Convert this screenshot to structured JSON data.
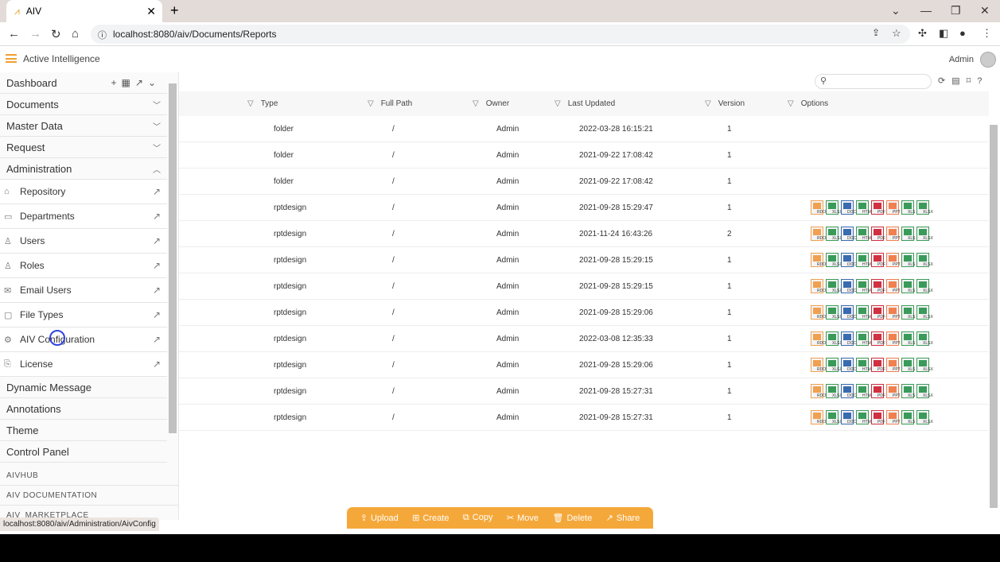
{
  "browser": {
    "tab_title": "AIV",
    "url": "localhost:8080/aiv/Documents/Reports",
    "status_url": "localhost:8080/aiv/Administration/AivConfig"
  },
  "app": {
    "brand": "Active Intelligence",
    "user": "Admin"
  },
  "sidebar": {
    "menus": [
      {
        "label": "Dashboard"
      },
      {
        "label": "Documents"
      },
      {
        "label": "Master Data"
      },
      {
        "label": "Request"
      },
      {
        "label": "Administration"
      }
    ],
    "admin_items": [
      {
        "label": "Repository",
        "icon": "repository-icon"
      },
      {
        "label": "Departments",
        "icon": "departments-icon"
      },
      {
        "label": "Users",
        "icon": "user-icon"
      },
      {
        "label": "Roles",
        "icon": "roles-icon"
      },
      {
        "label": "Email Users",
        "icon": "email-users-icon"
      },
      {
        "label": "File Types",
        "icon": "file-types-icon"
      },
      {
        "label": "AIV Configuration",
        "icon": "config-icon"
      },
      {
        "label": "License",
        "icon": "license-icon"
      }
    ],
    "more": [
      {
        "label": "Dynamic Message"
      },
      {
        "label": "Annotations"
      },
      {
        "label": "Theme"
      },
      {
        "label": "Control Panel"
      }
    ],
    "links": [
      {
        "label": "AIVHUB"
      },
      {
        "label": "AIV DOCUMENTATION"
      },
      {
        "label": "AIV_MARKETPLACE"
      }
    ]
  },
  "table": {
    "columns": [
      "Type",
      "Full Path",
      "Owner",
      "Last Updated",
      "Version",
      "Options"
    ],
    "rows": [
      {
        "type": "folder",
        "path": "/",
        "owner": "Admin",
        "updated": "2022-03-28 16:15:21",
        "version": "1",
        "opts": false
      },
      {
        "type": "folder",
        "path": "/",
        "owner": "Admin",
        "updated": "2021-09-22 17:08:42",
        "version": "1",
        "opts": false
      },
      {
        "type": "folder",
        "path": "/",
        "owner": "Admin",
        "updated": "2021-09-22 17:08:42",
        "version": "1",
        "opts": false
      },
      {
        "type": "rptdesign",
        "path": "/",
        "owner": "Admin",
        "updated": "2021-09-28 15:29:47",
        "version": "1",
        "opts": true
      },
      {
        "type": "rptdesign",
        "path": "/",
        "owner": "Admin",
        "updated": "2021-11-24 16:43:26",
        "version": "2",
        "opts": true
      },
      {
        "type": "rptdesign",
        "path": "/",
        "owner": "Admin",
        "updated": "2021-09-28 15:29:15",
        "version": "1",
        "opts": true
      },
      {
        "type": "rptdesign",
        "path": "/",
        "owner": "Admin",
        "updated": "2021-09-28 15:29:15",
        "version": "1",
        "opts": true
      },
      {
        "type": "rptdesign",
        "path": "/",
        "owner": "Admin",
        "updated": "2021-09-28 15:29:06",
        "version": "1",
        "opts": true
      },
      {
        "type": "rptdesign",
        "path": "/",
        "owner": "Admin",
        "updated": "2022-03-08 12:35:33",
        "version": "1",
        "opts": true
      },
      {
        "type": "rptdesign",
        "path": "/",
        "owner": "Admin",
        "updated": "2021-09-28 15:29:06",
        "version": "1",
        "opts": true
      },
      {
        "type": "rptdesign",
        "path": "/",
        "owner": "Admin",
        "updated": "2021-09-28 15:27:31",
        "version": "1",
        "opts": true
      },
      {
        "type": "rptdesign",
        "path": "/",
        "owner": "Admin",
        "updated": "2021-09-28 15:27:31",
        "version": "1",
        "opts": true
      }
    ],
    "formats": [
      {
        "label": "RDOC",
        "color": "#f0a050"
      },
      {
        "label": "XLSX",
        "color": "#3a9a5a"
      },
      {
        "label": "DOC",
        "color": "#3a6ab0"
      },
      {
        "label": "HTML",
        "color": "#3a9a5a"
      },
      {
        "label": "PDF",
        "color": "#d03040"
      },
      {
        "label": "PPT",
        "color": "#f08050"
      },
      {
        "label": "XLS",
        "color": "#3a9a5a"
      },
      {
        "label": "XLSX",
        "color": "#3a9a5a"
      }
    ]
  },
  "actions": [
    {
      "label": "Upload",
      "icon": "upload-icon",
      "glyph": "⇪"
    },
    {
      "label": "Create",
      "icon": "create-folder-icon",
      "glyph": "⊞"
    },
    {
      "label": "Copy",
      "icon": "copy-icon",
      "glyph": "⧉"
    },
    {
      "label": "Move",
      "icon": "scissors-icon",
      "glyph": "✂"
    },
    {
      "label": "Delete",
      "icon": "trash-icon",
      "glyph": "🗑"
    },
    {
      "label": "Share",
      "icon": "share-icon",
      "glyph": "↗"
    }
  ],
  "colors": {
    "accent": "#f5a83a"
  }
}
